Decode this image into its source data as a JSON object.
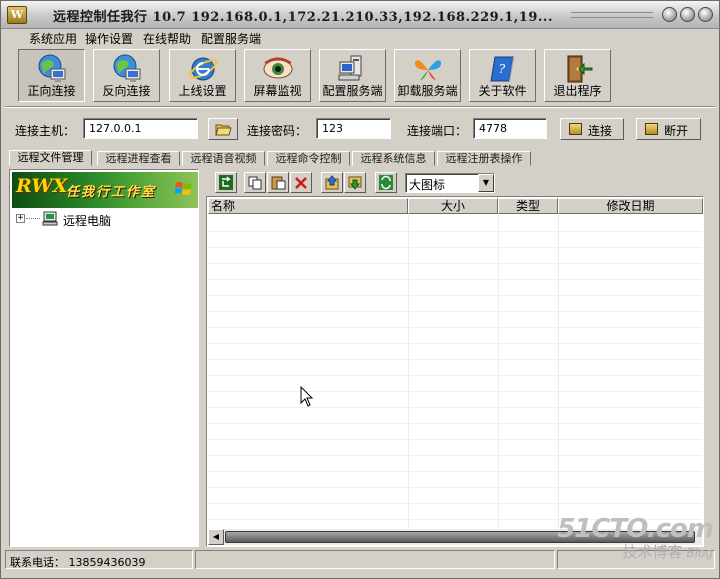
{
  "window": {
    "title": "远程控制任我行  10.7   192.168.0.1,172.21.210.33,192.168.229.1,19...",
    "app_icon_glyph": "W"
  },
  "menu": [
    "系统应用",
    "操作设置",
    "在线帮助",
    "配置服务端"
  ],
  "toolbar": [
    {
      "label": "正向连接",
      "icon": "globe-computer-icon",
      "active": true
    },
    {
      "label": "反向连接",
      "icon": "globe-computer-icon",
      "active": false
    },
    {
      "label": "上线设置",
      "icon": "ie-globe-icon",
      "active": false
    },
    {
      "label": "屏幕监视",
      "icon": "eye-icon",
      "active": false
    },
    {
      "label": "配置服务端",
      "icon": "computer-config-icon",
      "active": false
    },
    {
      "label": "卸载服务端",
      "icon": "msn-butterfly-icon",
      "active": false
    },
    {
      "label": "关于软件",
      "icon": "book-help-icon",
      "active": false
    },
    {
      "label": "退出程序",
      "icon": "exit-door-icon",
      "active": false
    }
  ],
  "connection": {
    "host_label": "连接主机：",
    "host_value": "127.0.0.1",
    "password_label": "连接密码：",
    "password_value": "123",
    "port_label": "连接端口：",
    "port_value": "4778",
    "connect_label": "连接",
    "disconnect_label": "断开"
  },
  "tabs": [
    "远程文件管理",
    "远程进程查看",
    "远程语音视频",
    "远程命令控制",
    "远程系统信息",
    "远程注册表操作"
  ],
  "active_tab": 0,
  "left_panel": {
    "banner_logo": "RWX",
    "banner_title": "任我行工作室",
    "tree_root": "远程电脑"
  },
  "file_toolbar": {
    "buttons": [
      "refresh-icon",
      "copy-icon",
      "paste-icon",
      "delete-icon",
      "upload-icon",
      "download-icon",
      "sync-icon"
    ],
    "view_value": "大图标"
  },
  "list_columns": [
    "名称",
    "大小",
    "类型",
    "修改日期"
  ],
  "status": {
    "phone": "联系电话： 13859436039"
  },
  "watermark": {
    "top": "51CTO.com",
    "bottom": "技术博客",
    "blog": "Blog"
  },
  "colors": {
    "chrome": "#d4d0c8",
    "banner_green": "#2d8b2a",
    "banner_text": "#ffd400"
  }
}
